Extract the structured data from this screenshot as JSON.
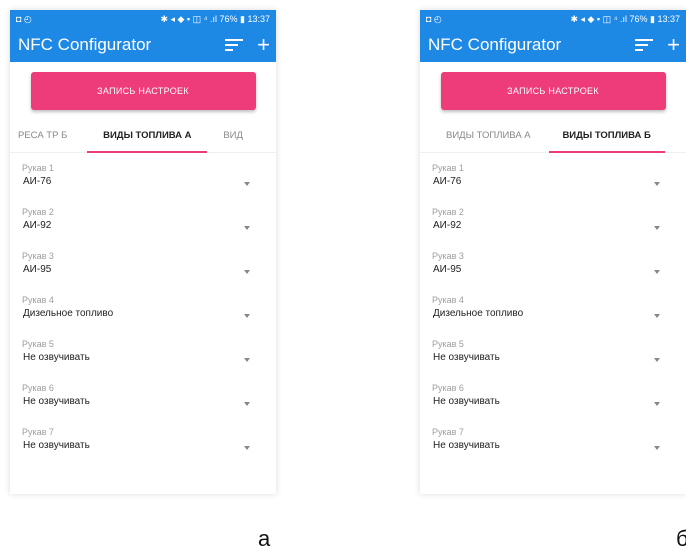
{
  "panels": [
    {
      "status": {
        "left": "◘ ◴",
        "right": "✱ ◂ ◆ ▪ ◫ ⁴ .ıl 76% ▮ 13:37"
      },
      "app_title": "NFC Configurator",
      "action_button": "ЗАПИСЬ НАСТРОЕК",
      "tabs": [
        "РЕСА ТР Б",
        "ВИДЫ ТОПЛИВА А",
        "ВИД"
      ],
      "active_tab": 1,
      "fields": [
        {
          "label": "Рукав 1",
          "value": "АИ-76"
        },
        {
          "label": "Рукав 2",
          "value": "АИ-92"
        },
        {
          "label": "Рукав 3",
          "value": "АИ-95"
        },
        {
          "label": "Рукав 4",
          "value": "Дизельное топливо"
        },
        {
          "label": "Рукав 5",
          "value": "Не озвучивать"
        },
        {
          "label": "Рукав 6",
          "value": "Не озвучивать"
        },
        {
          "label": "Рукав 7",
          "value": "Не озвучивать"
        }
      ],
      "caption": "а"
    },
    {
      "status": {
        "left": "◘ ◴",
        "right": "✱ ◂ ◆ ▪ ◫ ⁴ .ıl 76% ▮ 13:37"
      },
      "app_title": "NFC Configurator",
      "action_button": "ЗАПИСЬ НАСТРОЕК",
      "tabs": [
        "ВИДЫ ТОПЛИВА А",
        "ВИДЫ ТОПЛИВА Б"
      ],
      "active_tab": 1,
      "fields": [
        {
          "label": "Рукав 1",
          "value": "АИ-76"
        },
        {
          "label": "Рукав 2",
          "value": "АИ-92"
        },
        {
          "label": "Рукав 3",
          "value": "АИ-95"
        },
        {
          "label": "Рукав 4",
          "value": "Дизельное топливо"
        },
        {
          "label": "Рукав 5",
          "value": "Не озвучивать"
        },
        {
          "label": "Рукав 6",
          "value": "Не озвучивать"
        },
        {
          "label": "Рукав 7",
          "value": "Не озвучивать"
        }
      ],
      "caption": "б"
    }
  ],
  "colors": {
    "primary": "#1e88e5",
    "accent": "#ee3b7a"
  },
  "icons": {
    "menu": "sort-icon",
    "add": "plus-icon",
    "dropdown": "chevron-down-icon"
  }
}
